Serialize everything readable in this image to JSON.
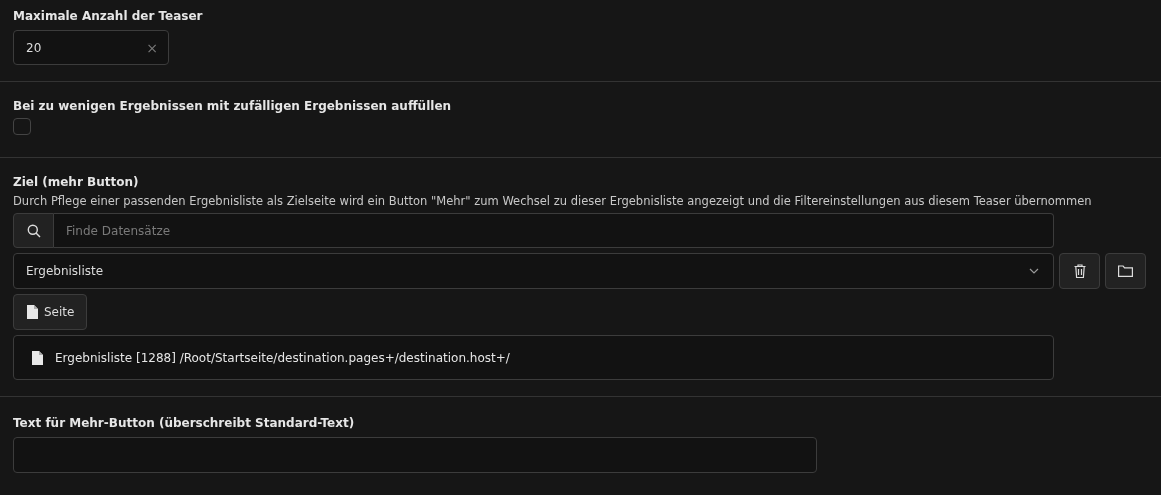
{
  "max_teaser": {
    "label": "Maximale Anzahl der Teaser",
    "value": "20",
    "clear": "×"
  },
  "fill_random": {
    "label": "Bei zu wenigen Ergebnissen mit zufälligen Ergebnissen auffüllen",
    "checked": false
  },
  "target": {
    "label": "Ziel (mehr Button)",
    "description": "Durch Pflege einer passenden Ergebnisliste als Zielseite wird ein Button \"Mehr\" zum Wechsel zu dieser Ergebnisliste angezeigt und die Filtereinstellungen aus diesem Teaser übernommen",
    "search_placeholder": "Finde Datensätze",
    "selected": "Ergebnisliste",
    "page_button": "Seite",
    "record": {
      "title": "Ergebnisliste",
      "id": "[1288]",
      "path": "/Root/Startseite/destination.pages+/destination.host+/"
    }
  },
  "more_text": {
    "label": "Text für Mehr-Button (überschreibt Standard-Text)"
  }
}
